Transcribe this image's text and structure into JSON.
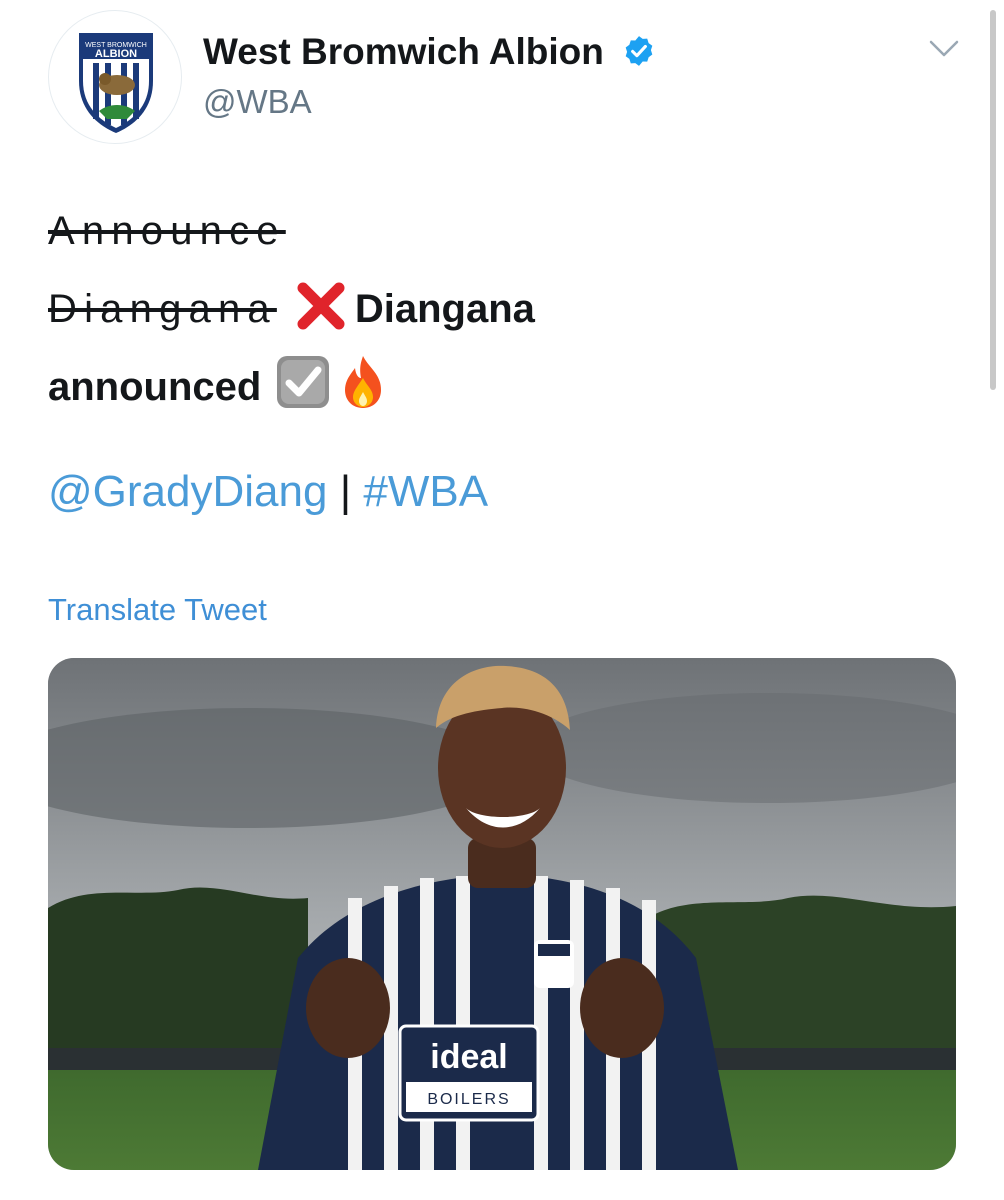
{
  "account": {
    "display_name": "West Bromwich Albion",
    "handle": "@WBA",
    "verified": true,
    "avatar_crest_text": [
      "WEST BROMWICH",
      "ALBION"
    ]
  },
  "tweet": {
    "struck_words": [
      "Announce",
      "Diangana"
    ],
    "bold_name": "Diangana",
    "bold_announced": "announced",
    "emojis": [
      "cross-mark-emoji",
      "check-box-emoji",
      "fire-emoji"
    ],
    "mention": "@GradyDiang",
    "separator": "|",
    "hashtag": "#WBA",
    "translate_label": "Translate Tweet"
  },
  "media": {
    "shirt_sponsor": [
      "ideal",
      "BOILERS"
    ]
  },
  "colors": {
    "link": "#4a9bd8",
    "verified": "#1da1f2",
    "cross": "#e0242b",
    "kit_navy": "#1b2a4a"
  }
}
